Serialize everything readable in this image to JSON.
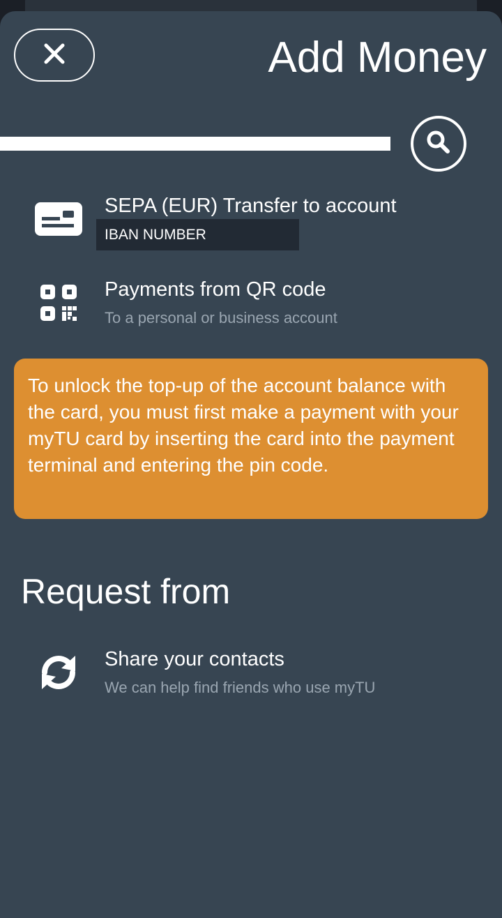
{
  "header": {
    "title": "Add Money",
    "close_icon": "close-icon"
  },
  "search": {
    "icon": "search-icon"
  },
  "options": [
    {
      "icon": "bank-card-icon",
      "title": "SEPA (EUR) Transfer to account",
      "subtitle": "IBAN NUMBER"
    },
    {
      "icon": "qr-code-icon",
      "title": "Payments from QR code",
      "subtitle": "To a personal or business account"
    }
  ],
  "notice": {
    "text": "To unlock the top-up of the account balance with the card, you must first make a payment with your myTU card by inserting the card into the payment terminal and entering the pin code.",
    "color": "#dd8f31"
  },
  "request": {
    "section_title": "Request from",
    "items": [
      {
        "icon": "sync-icon",
        "title": "Share your contacts",
        "subtitle": "We can help find friends who use myTU"
      }
    ]
  },
  "colors": {
    "background": "#374552",
    "accent": "#dd8f31"
  }
}
